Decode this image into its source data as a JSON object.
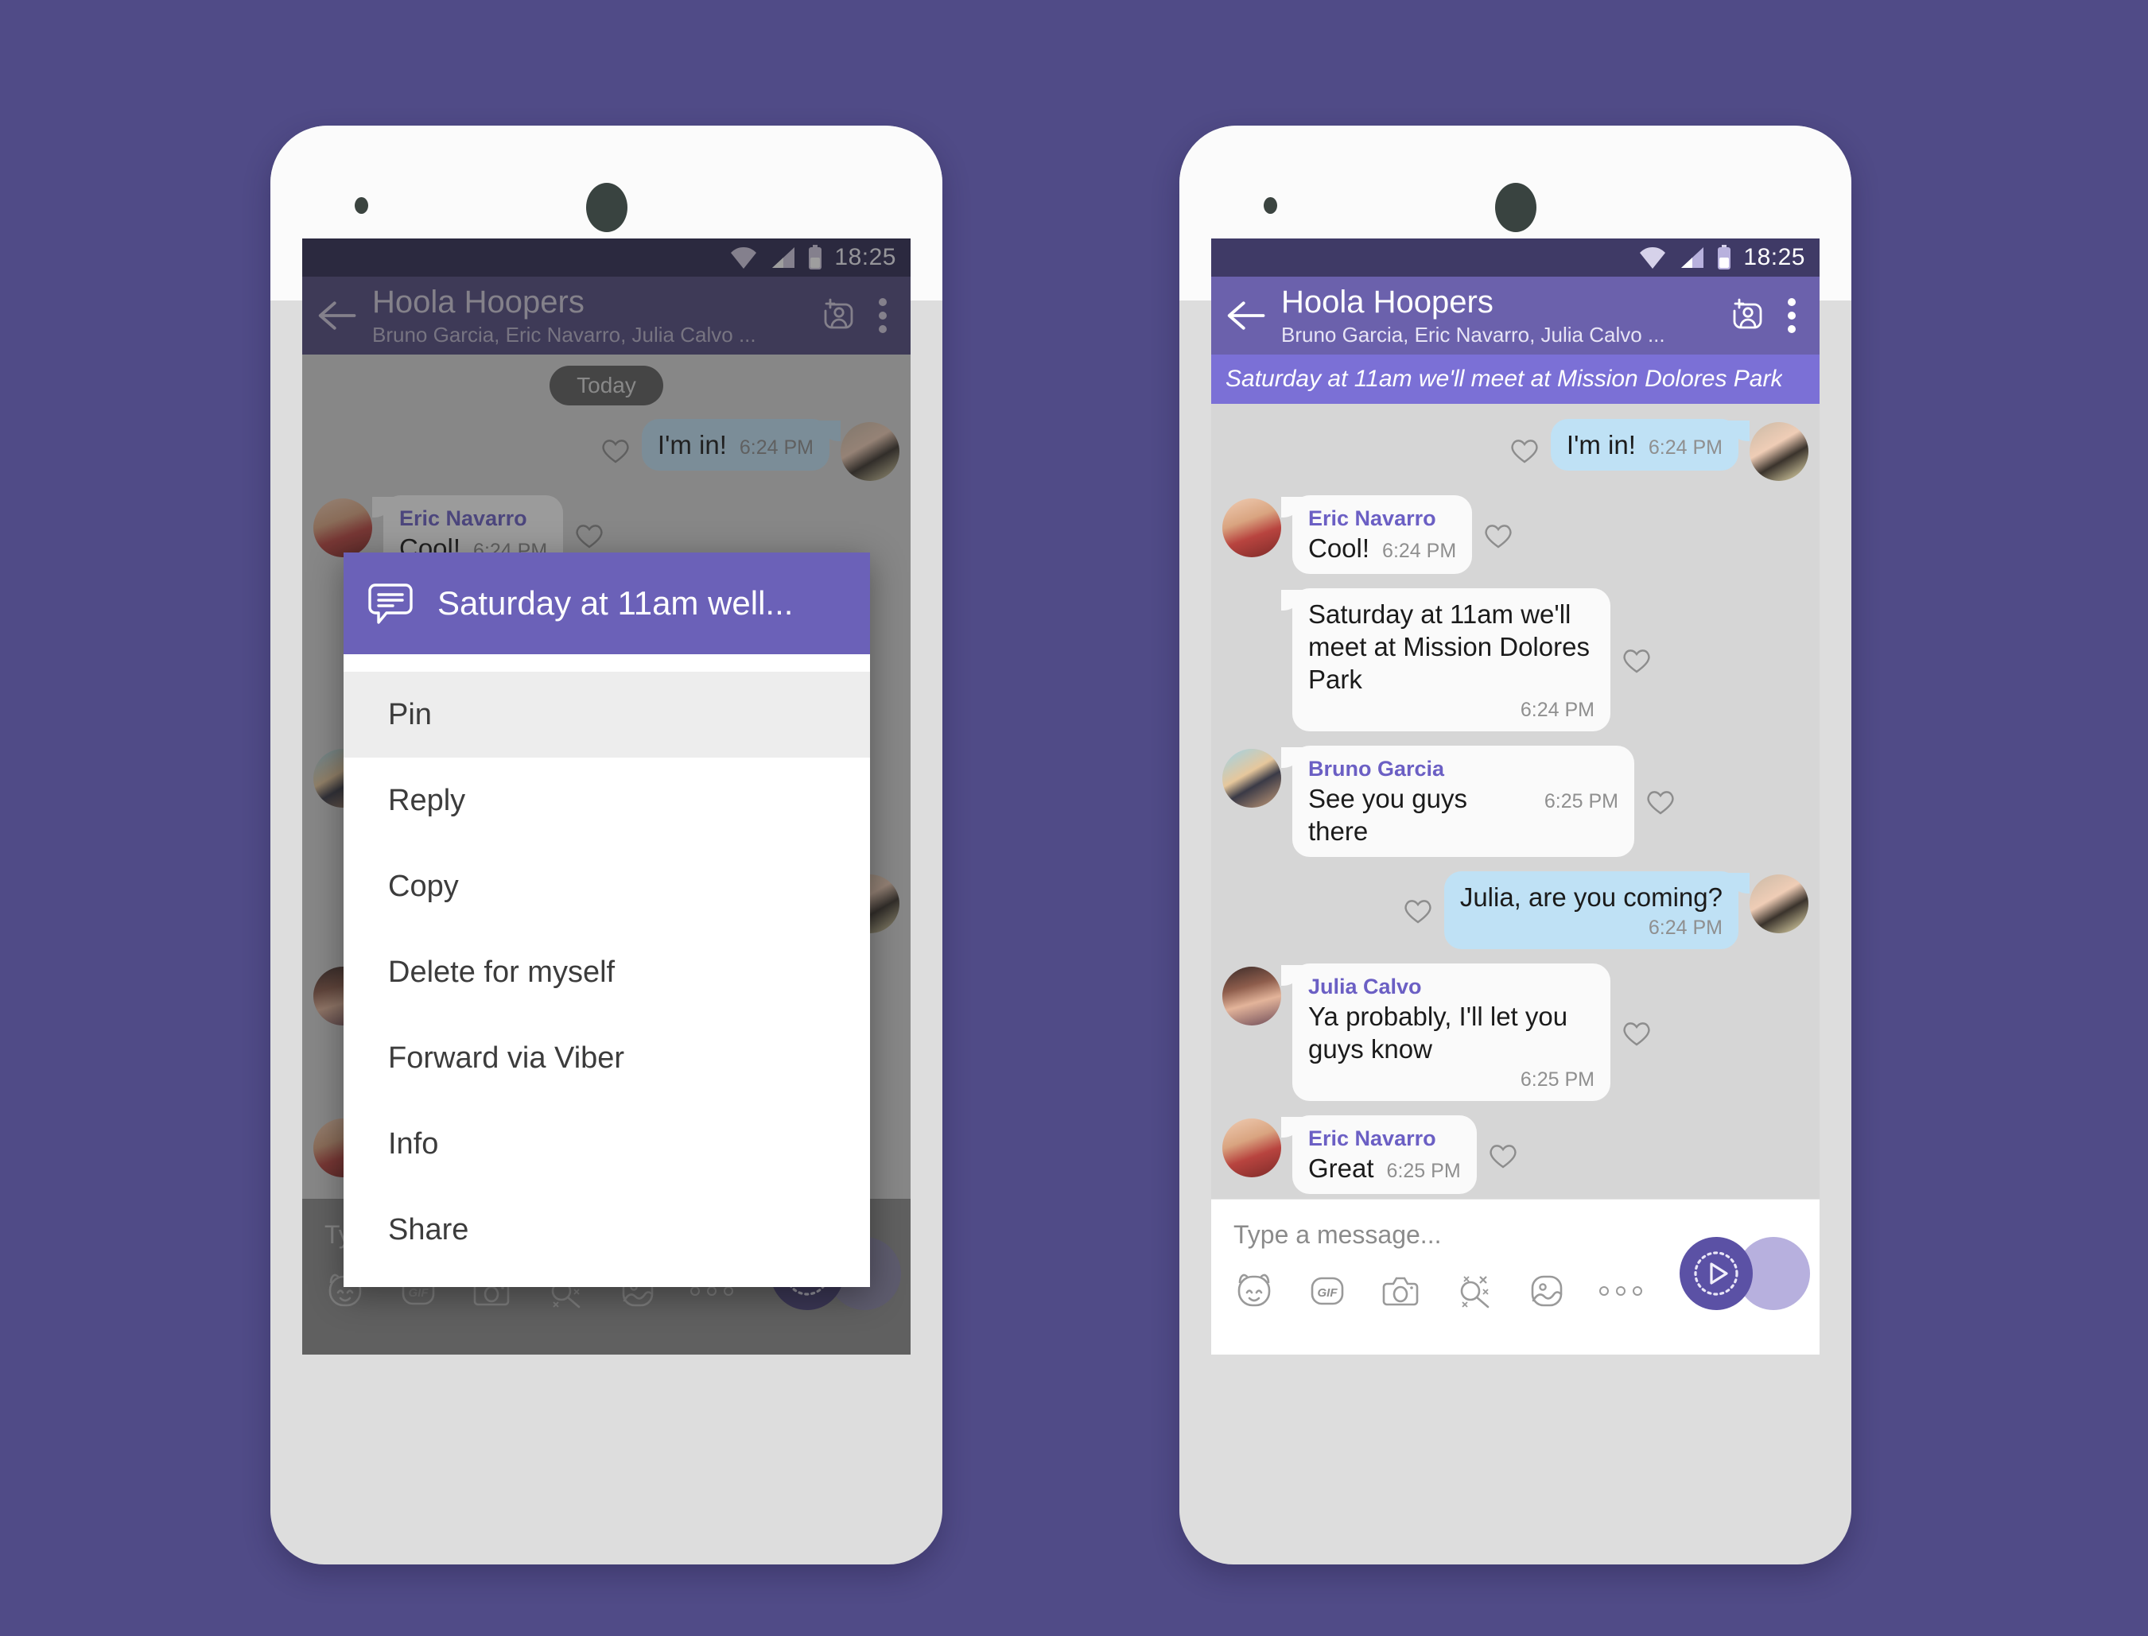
{
  "background_color": "#504b87",
  "status_bar": {
    "time": "18:25",
    "icons": [
      "wifi-icon",
      "signal-icon",
      "battery-icon"
    ]
  },
  "app_bar": {
    "back_icon": "back-arrow-icon",
    "title": "Hoola Hoopers",
    "subtitle": "Bruno Garcia, Eric Navarro, Julia Calvo ...",
    "add_participant_icon": "add-person-icon",
    "overflow_icon": "overflow-menu-icon"
  },
  "pinned_banner": {
    "text": "Saturday at 11am we'll meet at Mission Dolores Park"
  },
  "day_divider": "Today",
  "messages": [
    {
      "id": "m1",
      "direction": "out",
      "sender": "",
      "text": "I'm in!",
      "time": "6:24 PM",
      "avatar": "me",
      "like_icon": "heart-outline-icon"
    },
    {
      "id": "m2",
      "direction": "in",
      "sender": "Eric Navarro",
      "text": "Cool!",
      "time": "6:24 PM",
      "avatar": "eric",
      "like_icon": "heart-outline-icon"
    },
    {
      "id": "m3",
      "direction": "in",
      "sender": "",
      "text": "Saturday at 11am we'll meet at Mission Dolores Park",
      "time": "6:24 PM",
      "avatar": "",
      "like_icon": "heart-outline-icon"
    },
    {
      "id": "m4",
      "direction": "in",
      "sender": "Bruno Garcia",
      "text": "See you guys there",
      "time": "6:25 PM",
      "avatar": "bruno",
      "like_icon": "heart-outline-icon"
    },
    {
      "id": "m5",
      "direction": "out",
      "sender": "",
      "text": "Julia, are you coming?",
      "time": "6:24 PM",
      "avatar": "me",
      "like_icon": "heart-outline-icon"
    },
    {
      "id": "m6",
      "direction": "in",
      "sender": "Julia Calvo",
      "text": "Ya probably, I'll let you guys know",
      "time": "6:25 PM",
      "avatar": "julia",
      "like_icon": "heart-outline-icon"
    },
    {
      "id": "m7",
      "direction": "in",
      "sender": "Eric Navarro",
      "text": "Great",
      "time": "6:25 PM",
      "avatar": "eric",
      "like_icon": "heart-outline-icon"
    }
  ],
  "composer": {
    "placeholder": "Type a message...",
    "tools": [
      {
        "name": "sticker-icon",
        "label": ""
      },
      {
        "name": "gif-icon",
        "label": "GIF"
      },
      {
        "name": "camera-icon",
        "label": ""
      },
      {
        "name": "doodle-icon",
        "label": ""
      },
      {
        "name": "gallery-icon",
        "label": ""
      },
      {
        "name": "more-options-icon",
        "label": ""
      }
    ],
    "send_icon": "send-play-icon"
  },
  "context_menu": {
    "header_icon": "message-bubble-icon",
    "header_title": "Saturday at 11am well...",
    "items": [
      {
        "label": "Pin",
        "highlighted": true
      },
      {
        "label": "Reply",
        "highlighted": false
      },
      {
        "label": "Copy",
        "highlighted": false
      },
      {
        "label": "Delete for myself",
        "highlighted": false
      },
      {
        "label": "Forward via Viber",
        "highlighted": false
      },
      {
        "label": "Info",
        "highlighted": false
      },
      {
        "label": "Share",
        "highlighted": false
      }
    ]
  },
  "colors": {
    "status_bar": "#3f3a66",
    "app_bar": "#6b61ac",
    "pinned_banner": "#7b70d6",
    "chat_background": "#d6d6d6",
    "incoming_bubble": "#fafafa",
    "outgoing_bubble": "#bfe1f5",
    "sender_name": "#6b5fc4",
    "send_button": "#5b51a5",
    "dialog_header": "#6b61b8"
  }
}
